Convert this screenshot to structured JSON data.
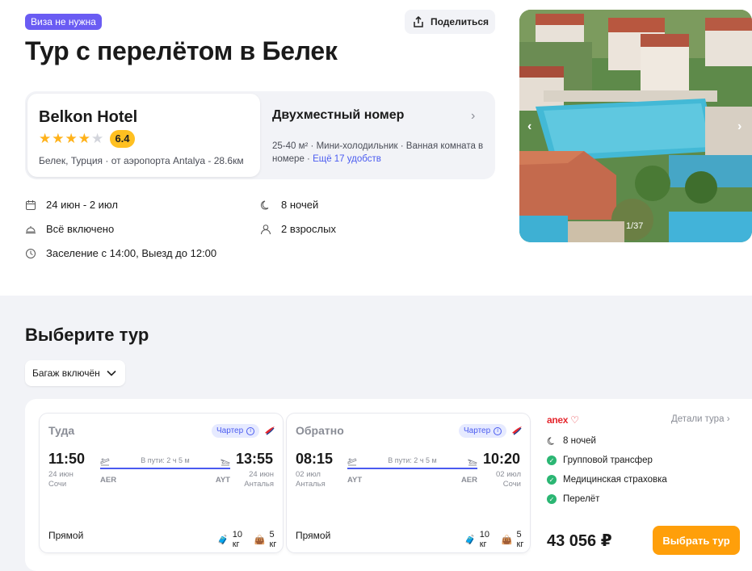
{
  "header": {
    "visa_badge": "Виза не нужна",
    "share_label": "Поделиться",
    "title": "Тур с перелётом в Белек"
  },
  "hotel": {
    "name": "Belkon Hotel",
    "stars": 4,
    "stars_max": 5,
    "rating": "6.4",
    "location": "Белек, Турция",
    "airport": "от аэропорта Antalya - 28.6км",
    "location_sep": "·"
  },
  "room": {
    "title": "Двухместный номер",
    "desc": "25-40 м² · Мини-холодильник · Ванная комната в номере · ",
    "more_link": "Ещё 17 удобств"
  },
  "details": {
    "dates": "24 июн - 2 июл",
    "nights": "8 ночей",
    "meal": "Всё включено",
    "guests": "2 взрослых",
    "checkin": "Заселение с 14:00, Выезд до 12:00"
  },
  "photo": {
    "counter": "1/37"
  },
  "tours": {
    "section_title": "Выберите тур",
    "filter_label": "Багаж включён",
    "outbound": {
      "title": "Туда",
      "charter": "Чартер",
      "depart_time": "11:50",
      "depart_date": "24 июн",
      "depart_city": "Сочи",
      "arrive_time": "13:55",
      "arrive_date": "24 июн",
      "arrive_city": "Анталья",
      "duration": "В пути: 2 ч 5 м",
      "from_iata": "AER",
      "to_iata": "AYT",
      "type": "Прямой",
      "baggage": "10 кг",
      "hand_luggage": "5 кг"
    },
    "return": {
      "title": "Обратно",
      "charter": "Чартер",
      "depart_time": "08:15",
      "depart_date": "02 июл",
      "depart_city": "Анталья",
      "arrive_time": "10:20",
      "arrive_date": "02 июл",
      "arrive_city": "Сочи",
      "duration": "В пути: 2 ч 5 м",
      "from_iata": "AYT",
      "to_iata": "AER",
      "type": "Прямой",
      "baggage": "10 кг",
      "hand_luggage": "5 кг"
    },
    "operator": "anex",
    "details_link": "Детали тура",
    "nights": "8 ночей",
    "features": [
      "Групповой трансфер",
      "Медицинская страховка",
      "Перелёт"
    ],
    "price": "43 056 ₽",
    "choose_label": "Выбрать тур"
  },
  "colors": {
    "accent": "#4a5bf0",
    "orange": "#ff9f0a",
    "visa": "#6a5cf3",
    "green": "#2bb673",
    "anex": "#e5262d"
  }
}
